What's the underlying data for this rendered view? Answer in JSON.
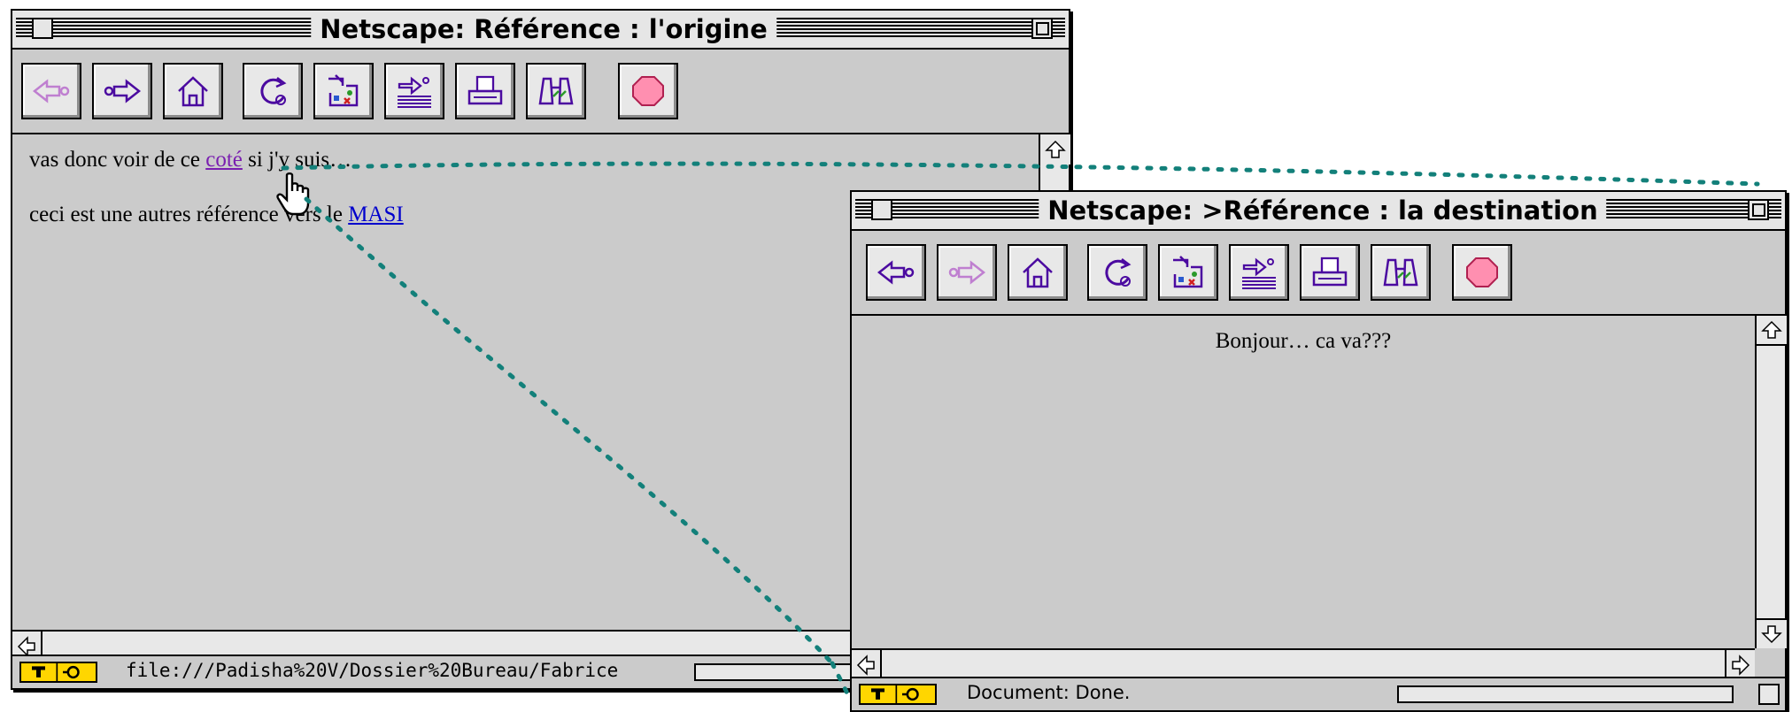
{
  "windows": {
    "origin": {
      "title": "Netscape: Référence : l'origine",
      "content": {
        "line1_before": "vas donc voir de ce ",
        "line1_link": "coté",
        "line1_after": " si j'y suis…",
        "line2_before": "ceci est une autres référence vers le ",
        "line2_link": "MASI"
      },
      "status_text": "file:///Padisha%20V/Dossier%20Bureau/Fabrice"
    },
    "destination": {
      "title": "Netscape: >Référence : la destination",
      "content": {
        "greeting": "Bonjour… ca va???"
      },
      "status_text": "Document: Done."
    }
  },
  "toolbar_icons": [
    "back-icon",
    "forward-icon",
    "home-icon",
    "reload-icon",
    "images-icon",
    "open-icon",
    "print-icon",
    "find-icon",
    "stop-icon"
  ],
  "colors": {
    "chrome": "#cbcbcb",
    "link": "#0000cc",
    "visited_link": "#7a1fb0",
    "connector": "#13807a",
    "stop": "#ff8fb0"
  }
}
